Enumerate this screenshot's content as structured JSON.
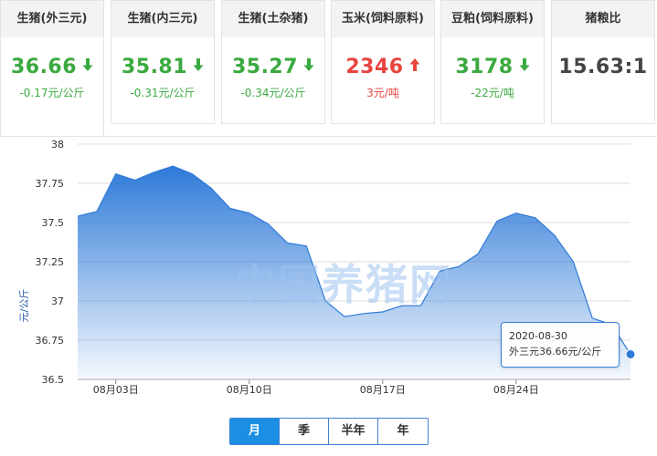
{
  "cards": [
    {
      "title": "生猪(外三元)",
      "price": "36.66",
      "change": "-0.17元/公斤",
      "trend": "down"
    },
    {
      "title": "生猪(内三元)",
      "price": "35.81",
      "change": "-0.31元/公斤",
      "trend": "down"
    },
    {
      "title": "生猪(土杂猪)",
      "price": "35.27",
      "change": "-0.34元/公斤",
      "trend": "down"
    },
    {
      "title": "玉米(饲料原料)",
      "price": "2346",
      "change": "3元/吨",
      "trend": "up"
    },
    {
      "title": "豆粕(饲料原料)",
      "price": "3178",
      "change": "-22元/吨",
      "trend": "down"
    },
    {
      "title": "猪粮比",
      "price": "15.63:1",
      "change": "",
      "trend": "none"
    }
  ],
  "colors": {
    "up": "#e8443f",
    "down": "#3aa93f",
    "accent": "#1a8fe3",
    "series": "#2e7ad8"
  },
  "watermark": "中国养猪网",
  "tooltip": {
    "date": "2020-08-30",
    "text": "外三元36.66元/公斤"
  },
  "ranges": [
    {
      "label": "月",
      "active": true
    },
    {
      "label": "季",
      "active": false
    },
    {
      "label": "半年",
      "active": false
    },
    {
      "label": "年",
      "active": false
    }
  ],
  "chart_data": {
    "type": "area",
    "ylabel": "元/公斤",
    "ylim": [
      36.5,
      38
    ],
    "yticks": [
      "38",
      "37.75",
      "37.5",
      "37.25",
      "37",
      "36.75",
      "36.5"
    ],
    "xticks": [
      "08月03日",
      "08月10日",
      "08月17日",
      "08月24日"
    ],
    "grid": true,
    "series": [
      {
        "x": [
          "2020-08-01",
          "2020-08-02",
          "2020-08-03",
          "2020-08-04",
          "2020-08-05",
          "2020-08-06",
          "2020-08-07",
          "2020-08-08",
          "2020-08-09",
          "2020-08-10",
          "2020-08-11",
          "2020-08-12",
          "2020-08-13",
          "2020-08-14",
          "2020-08-15",
          "2020-08-16",
          "2020-08-17",
          "2020-08-18",
          "2020-08-19",
          "2020-08-20",
          "2020-08-21",
          "2020-08-22",
          "2020-08-23",
          "2020-08-24",
          "2020-08-25",
          "2020-08-26",
          "2020-08-27",
          "2020-08-28",
          "2020-08-29",
          "2020-08-30"
        ],
        "values": [
          37.54,
          37.57,
          37.81,
          37.77,
          37.82,
          37.86,
          37.81,
          37.72,
          37.59,
          37.56,
          37.49,
          37.37,
          37.35,
          37.0,
          36.9,
          36.92,
          36.93,
          36.97,
          36.97,
          37.19,
          37.22,
          37.3,
          37.51,
          37.56,
          37.53,
          37.42,
          37.25,
          36.89,
          36.85,
          36.66
        ]
      }
    ]
  }
}
